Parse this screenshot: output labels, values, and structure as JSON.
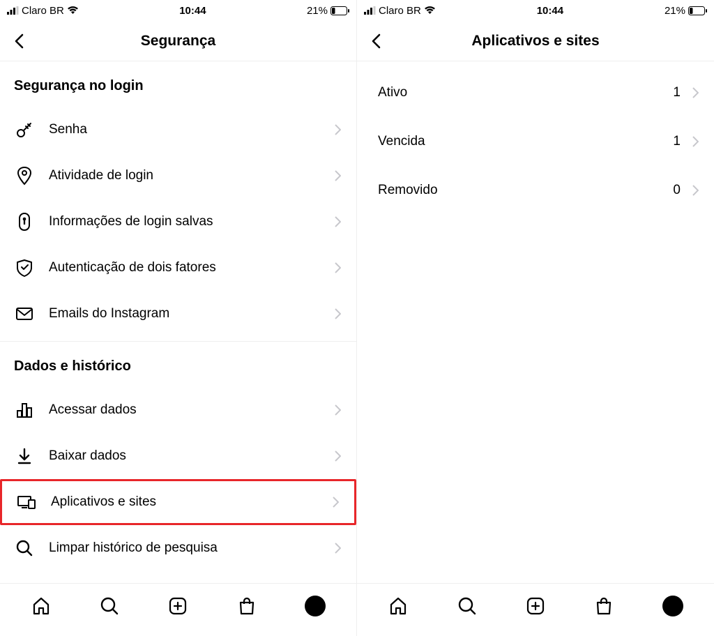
{
  "status": {
    "carrier": "Claro BR",
    "time": "10:44",
    "battery": "21%"
  },
  "left_screen": {
    "header": {
      "title": "Segurança"
    },
    "sections": [
      {
        "title": "Segurança no login",
        "items": [
          {
            "label": "Senha",
            "icon": "key-icon"
          },
          {
            "label": "Atividade de login",
            "icon": "location-pin-icon"
          },
          {
            "label": "Informações de login salvas",
            "icon": "keyhole-icon"
          },
          {
            "label": "Autenticação de dois fatores",
            "icon": "shield-check-icon"
          },
          {
            "label": "Emails do Instagram",
            "icon": "mail-icon"
          }
        ]
      },
      {
        "title": "Dados e histórico",
        "items": [
          {
            "label": "Acessar dados",
            "icon": "bar-chart-icon"
          },
          {
            "label": "Baixar dados",
            "icon": "download-icon"
          },
          {
            "label": "Aplicativos e sites",
            "icon": "devices-icon",
            "highlight": true
          },
          {
            "label": "Limpar histórico de pesquisa",
            "icon": "search-icon"
          }
        ]
      }
    ]
  },
  "right_screen": {
    "header": {
      "title": "Aplicativos e sites"
    },
    "items": [
      {
        "label": "Ativo",
        "count": "1"
      },
      {
        "label": "Vencida",
        "count": "1"
      },
      {
        "label": "Removido",
        "count": "0"
      }
    ]
  }
}
